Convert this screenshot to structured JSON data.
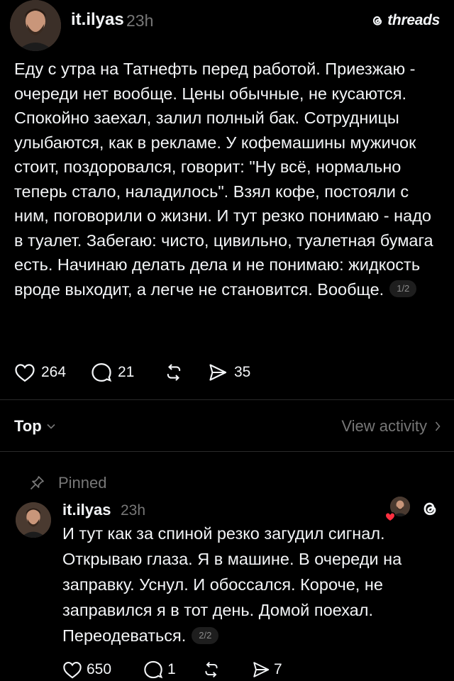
{
  "brand": {
    "name": "threads",
    "icon": "threads-logo-icon"
  },
  "post": {
    "username": "it.ilyas",
    "time": "23h",
    "text": "Еду с утра на Татнефть перед работой. Приезжаю - очереди нет вообще. Цены обычные, не кусаются. Спокойно заехал, залил полный бак. Сотрудницы улыбаются, как в рекламе. У кофемашины мужичок стоит, поздоровался, говорит: \"Ну всё, нормально теперь стало, наладилось\". Взял кофе, постояли с ним, поговорили о жизни. И тут резко понимаю - надо в туалет. Забегаю: чисто, цивильно, туалетная бумага есть. Начинаю делать дела и не понимаю: жидкость вроде выходит, а легче не становится. Вообще.",
    "page": "1/2",
    "likes": "264",
    "replies": "21",
    "shares": "35"
  },
  "sort": {
    "label": "Top",
    "view_activity": "View activity"
  },
  "reply": {
    "pinned_label": "Pinned",
    "username": "it.ilyas",
    "time": "23h",
    "text": "И тут как за спиной резко загудил сигнал. Открываю глаза. Я в машине. В очереди на заправку. Уснул. И обоссался. Короче, не заправился я в тот день. Домой поехал. Переодеваться.",
    "page": "2/2",
    "likes": "650",
    "replies": "1",
    "shares": "7"
  },
  "colors": {
    "background": "#000000",
    "text": "#f3f5f7",
    "muted": "#777777",
    "like_heart": "#ff3040"
  }
}
